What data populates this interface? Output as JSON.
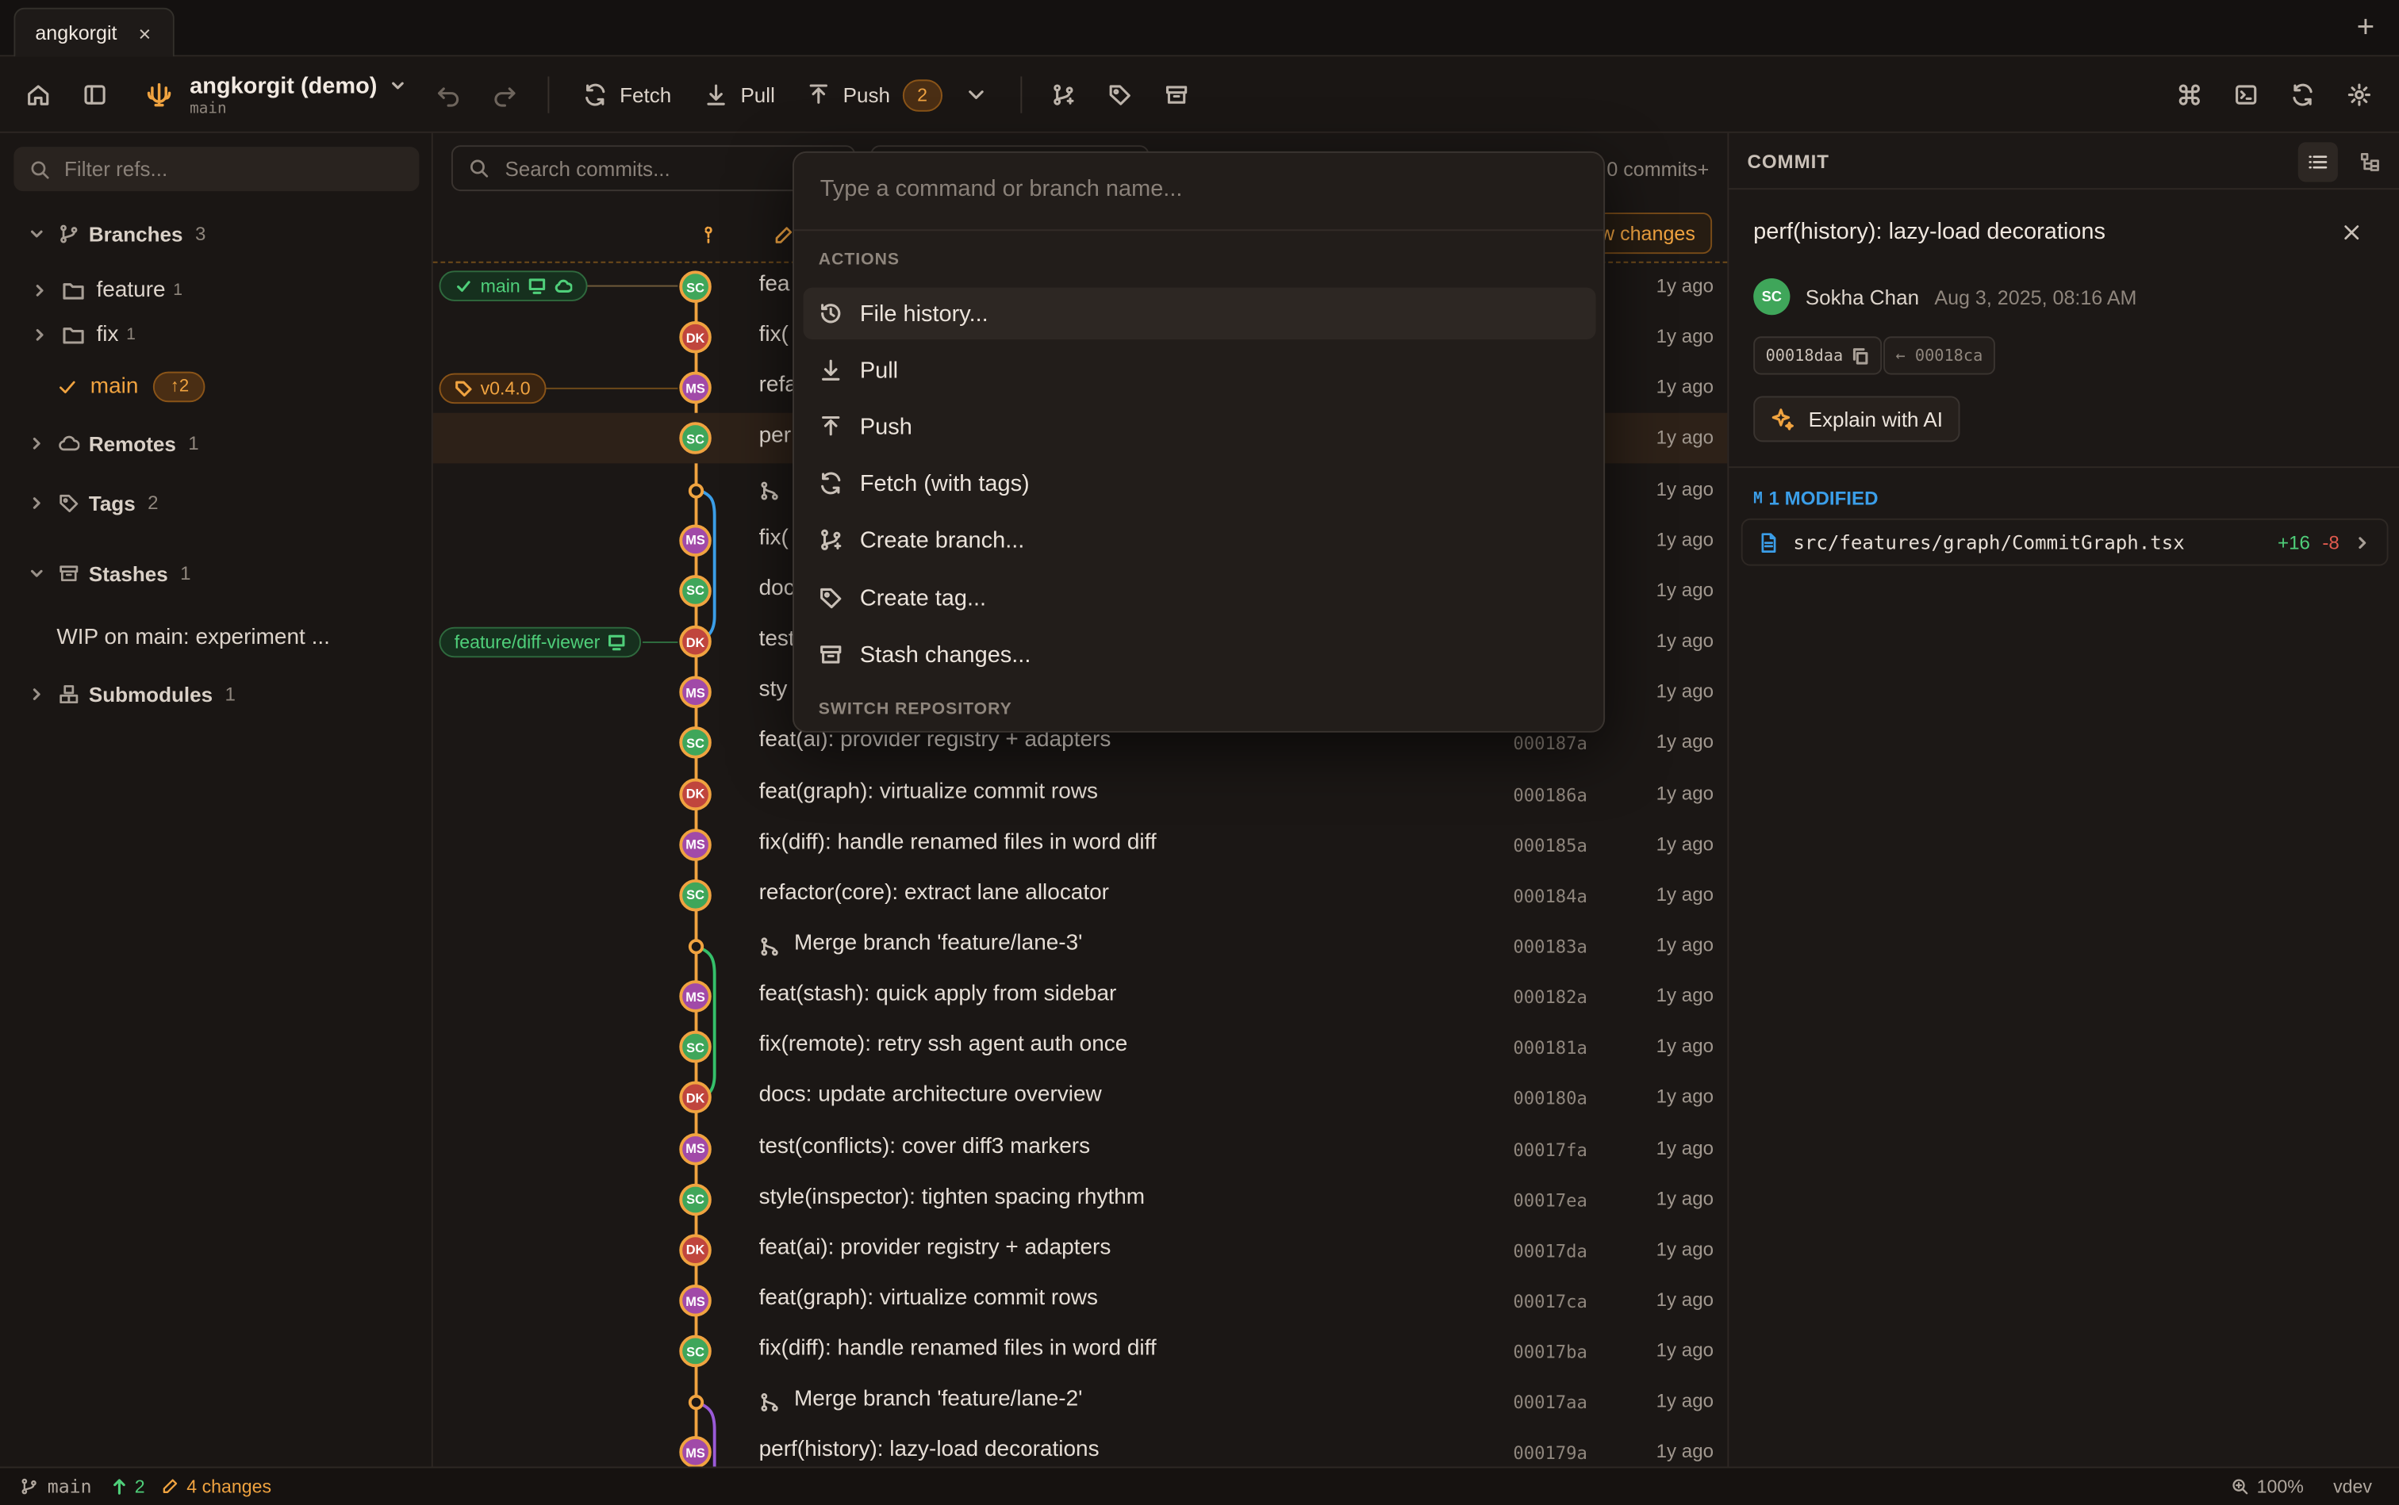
{
  "tab": {
    "title": "angkorgit",
    "close": "×",
    "new": "+"
  },
  "toolbar": {
    "repo_name": "angkorgit (demo)",
    "repo_branch": "main",
    "fetch": "Fetch",
    "pull": "Pull",
    "push": "Push",
    "push_count": "2"
  },
  "sidebar": {
    "filter_placeholder": "Filter refs...",
    "branches": {
      "label": "Branches",
      "count": "3"
    },
    "feature": {
      "label": "feature",
      "count": "1"
    },
    "fix": {
      "label": "fix",
      "count": "1"
    },
    "main": {
      "label": "main",
      "ahead": "↑2"
    },
    "remotes": {
      "label": "Remotes",
      "count": "1"
    },
    "tags": {
      "label": "Tags",
      "count": "2"
    },
    "stashes": {
      "label": "Stashes",
      "count": "1"
    },
    "stash_item": "WIP on main: experiment ...",
    "submodules": {
      "label": "Submodules",
      "count": "1"
    }
  },
  "main": {
    "search_placeholder": "Search commits...",
    "commits_count": "0 commits+",
    "view_changes": "ew changes",
    "ref_main": "main",
    "ref_tag": "v0.4.0",
    "ref_feature": "feature/diff-viewer",
    "commits": [
      {
        "msg": "fea",
        "hash": "",
        "ago": "1y ago",
        "av": "SC"
      },
      {
        "msg": "fix(",
        "hash": "",
        "ago": "1y ago",
        "av": "DK"
      },
      {
        "msg": "refa",
        "hash": "",
        "ago": "1y ago",
        "av": "MS"
      },
      {
        "msg": "per",
        "hash": "",
        "ago": "1y ago",
        "av": "SC"
      },
      {
        "msg": "",
        "hash": "",
        "ago": "1y ago",
        "av": ""
      },
      {
        "msg": "fix(",
        "hash": "",
        "ago": "1y ago",
        "av": "MS"
      },
      {
        "msg": "doc",
        "hash": "",
        "ago": "1y ago",
        "av": "SC"
      },
      {
        "msg": "test",
        "hash": "",
        "ago": "1y ago",
        "av": "DK"
      },
      {
        "msg": "sty",
        "hash": "",
        "ago": "1y ago",
        "av": "MS"
      },
      {
        "msg": "feat(ai): provider registry + adapters",
        "hash": "000187a",
        "ago": "1y ago",
        "av": "SC"
      },
      {
        "msg": "feat(graph): virtualize commit rows",
        "hash": "000186a",
        "ago": "1y ago",
        "av": "DK"
      },
      {
        "msg": "fix(diff): handle renamed files in word diff",
        "hash": "000185a",
        "ago": "1y ago",
        "av": "MS"
      },
      {
        "msg": "refactor(core): extract lane allocator",
        "hash": "000184a",
        "ago": "1y ago",
        "av": "SC"
      },
      {
        "msg": "Merge branch 'feature/lane-3'",
        "hash": "000183a",
        "ago": "1y ago",
        "av": ""
      },
      {
        "msg": "feat(stash): quick apply from sidebar",
        "hash": "000182a",
        "ago": "1y ago",
        "av": "MS"
      },
      {
        "msg": "fix(remote): retry ssh agent auth once",
        "hash": "000181a",
        "ago": "1y ago",
        "av": "SC"
      },
      {
        "msg": "docs: update architecture overview",
        "hash": "000180a",
        "ago": "1y ago",
        "av": "DK"
      },
      {
        "msg": "test(conflicts): cover diff3 markers",
        "hash": "00017fa",
        "ago": "1y ago",
        "av": "MS"
      },
      {
        "msg": "style(inspector): tighten spacing rhythm",
        "hash": "00017ea",
        "ago": "1y ago",
        "av": "SC"
      },
      {
        "msg": "feat(ai): provider registry + adapters",
        "hash": "00017da",
        "ago": "1y ago",
        "av": "DK"
      },
      {
        "msg": "feat(graph): virtualize commit rows",
        "hash": "00017ca",
        "ago": "1y ago",
        "av": "MS"
      },
      {
        "msg": "fix(diff): handle renamed files in word diff",
        "hash": "00017ba",
        "ago": "1y ago",
        "av": "SC"
      },
      {
        "msg": "Merge branch 'feature/lane-2'",
        "hash": "00017aa",
        "ago": "1y ago",
        "av": ""
      },
      {
        "msg": "perf(history): lazy-load decorations",
        "hash": "000179a",
        "ago": "1y ago",
        "av": "MS"
      }
    ]
  },
  "palette": {
    "placeholder": "Type a command or branch name...",
    "actions_header": "ACTIONS",
    "items": [
      "File history...",
      "Pull",
      "Push",
      "Fetch (with tags)",
      "Create branch...",
      "Create tag...",
      "Stash changes..."
    ],
    "switch_header": "SWITCH REPOSITORY"
  },
  "commit_panel": {
    "header": "COMMIT",
    "title": "perf(history): lazy-load decorations",
    "author_initials": "SC",
    "author": "Sokha Chan",
    "date": "Aug 3, 2025, 08:16 AM",
    "hash": "00018daa",
    "parent": "← 00018ca",
    "explain": "Explain with AI",
    "modified_header": "1 MODIFIED",
    "modified_letter": "M",
    "file": "src/features/graph/CommitGraph.tsx",
    "added": "+16",
    "removed": "-8"
  },
  "status": {
    "branch": "main",
    "ahead": "2",
    "changes": "4 changes",
    "zoom": "100%",
    "env": "vdev"
  },
  "colors": {
    "accent": "#f0a340",
    "sc": "#3fa65a",
    "dk": "#c0453d",
    "ms": "#a14aa8",
    "lane_blue": "#3b9ee8",
    "lane_green": "#35c06a",
    "lane_purple": "#9a5ad8"
  }
}
